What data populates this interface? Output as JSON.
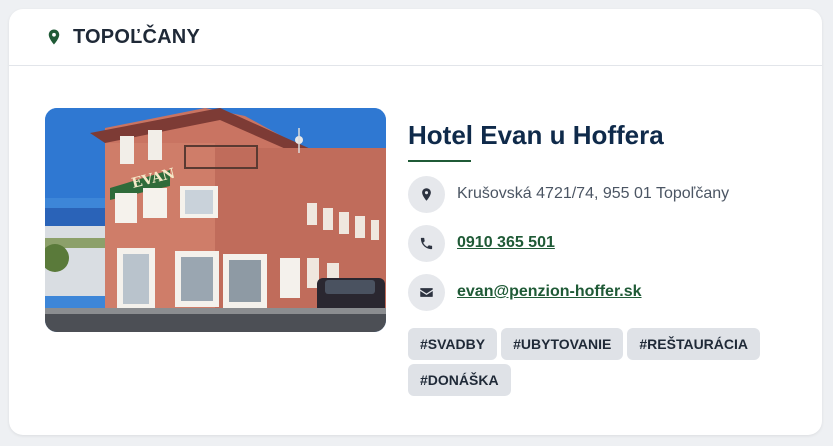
{
  "header": {
    "city": "TOPOĽČANY",
    "icon": "map-pin-icon"
  },
  "hotel": {
    "name": "Hotel Evan u Hoffera",
    "photo_alt": "Hotel Evan u Hoffera",
    "photo_sign_text": "EVAN"
  },
  "contacts": {
    "address": {
      "icon": "map-pin-icon",
      "text": "Krušovská 4721/74, 955 01 Topoľčany"
    },
    "phone": {
      "icon": "phone-icon",
      "text": "0910 365 501"
    },
    "email": {
      "icon": "envelope-icon",
      "text": "evan@penzion-hoffer.sk"
    }
  },
  "tags": [
    "#SVADBY",
    "#UBYTOVANIE",
    "#REŠTAURÁCIA",
    "#DONÁŠKA"
  ],
  "colors": {
    "accent_green": "#1f5a36",
    "title_navy": "#0f2a4a",
    "tag_bg": "#dfe2e7",
    "icon_bg": "#e6e8ec"
  }
}
